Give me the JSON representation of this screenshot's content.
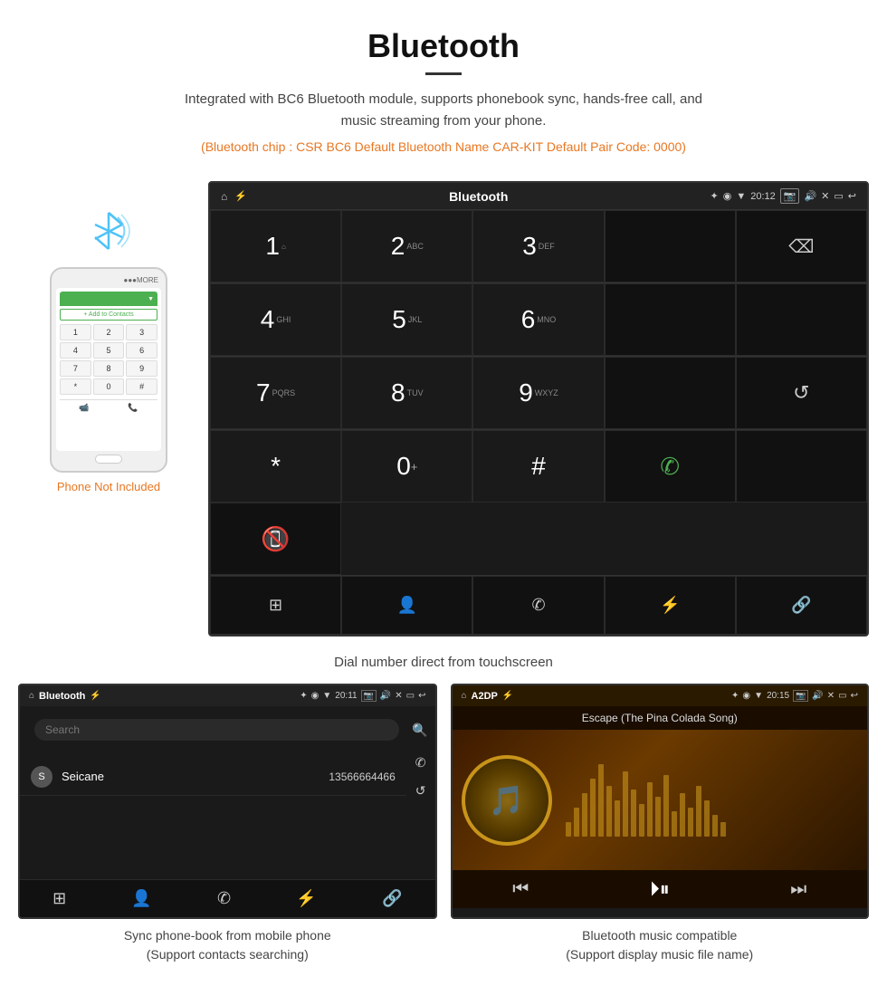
{
  "header": {
    "title": "Bluetooth",
    "description": "Integrated with BC6 Bluetooth module, supports phonebook sync, hands-free call, and music streaming from your phone.",
    "specs": "(Bluetooth chip : CSR BC6    Default Bluetooth Name CAR-KIT    Default Pair Code: 0000)"
  },
  "phone_mockup": {
    "not_included_label": "Phone Not Included",
    "top_bar_text": "MORE",
    "contact_btn_text": "+ Add to Contacts",
    "dialpad_keys": [
      "1",
      "2",
      "3",
      "4",
      "5",
      "6",
      "7",
      "8",
      "9",
      "*",
      "0",
      "#"
    ]
  },
  "car_screen": {
    "statusbar": {
      "title": "Bluetooth",
      "time": "20:12"
    },
    "dial_keys": [
      {
        "num": "1",
        "sub": ""
      },
      {
        "num": "2",
        "sub": "ABC"
      },
      {
        "num": "3",
        "sub": "DEF"
      },
      {
        "num": "",
        "sub": ""
      },
      {
        "num": "⌫",
        "sub": ""
      },
      {
        "num": "4",
        "sub": "GHI"
      },
      {
        "num": "5",
        "sub": "JKL"
      },
      {
        "num": "6",
        "sub": "MNO"
      },
      {
        "num": "",
        "sub": ""
      },
      {
        "num": "",
        "sub": ""
      },
      {
        "num": "7",
        "sub": "PQRS"
      },
      {
        "num": "8",
        "sub": "TUV"
      },
      {
        "num": "9",
        "sub": "WXYZ"
      },
      {
        "num": "",
        "sub": ""
      },
      {
        "num": "↺",
        "sub": ""
      },
      {
        "num": "*",
        "sub": ""
      },
      {
        "num": "0",
        "sub": "+"
      },
      {
        "num": "#",
        "sub": ""
      },
      {
        "num": "📞",
        "sub": "green"
      },
      {
        "num": "",
        "sub": ""
      },
      {
        "num": "📵",
        "sub": "red"
      }
    ]
  },
  "caption_dial": "Dial number direct from touchscreen",
  "bottom_left": {
    "statusbar": {
      "title": "Bluetooth",
      "time": "20:11"
    },
    "search_placeholder": "Search",
    "contact": {
      "initial": "S",
      "name": "Seicane",
      "phone": "13566664466"
    },
    "caption_line1": "Sync phone-book from mobile phone",
    "caption_line2": "(Support contacts searching)"
  },
  "bottom_right": {
    "statusbar": {
      "title": "A2DP",
      "time": "20:15"
    },
    "song_title": "Escape (The Pina Colada Song)",
    "caption_line1": "Bluetooth music compatible",
    "caption_line2": "(Support display music file name)"
  }
}
